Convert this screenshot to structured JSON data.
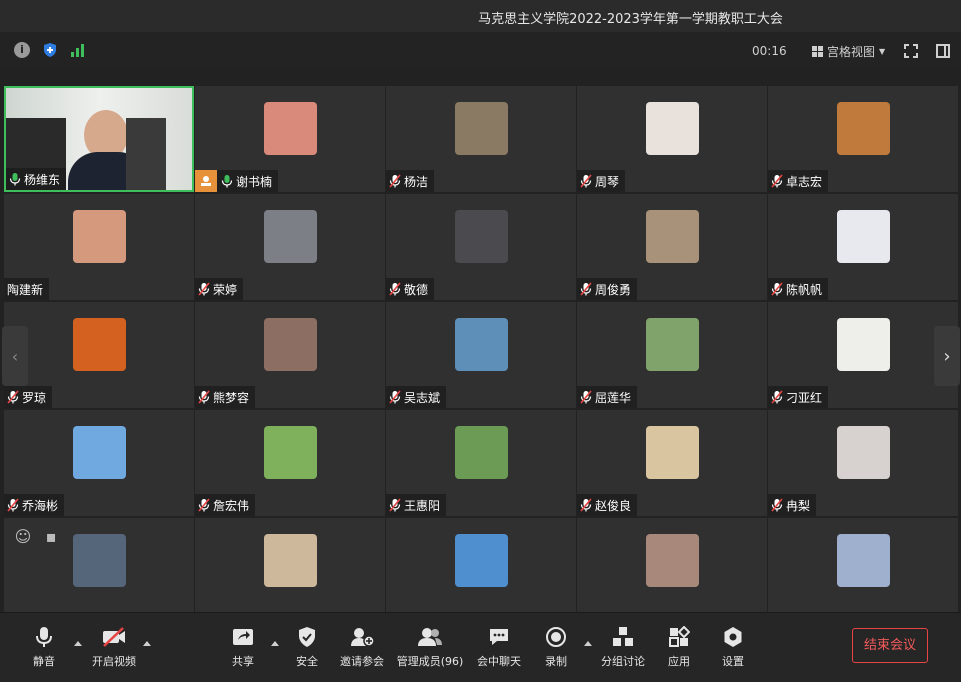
{
  "window": {
    "title": "马克思主义学院2022-2023学年第一学期教职工大会"
  },
  "infobar": {
    "timer": "00:16",
    "view_label": "宫格视图"
  },
  "participants": [
    {
      "name": "杨维东",
      "color": "#b9c7b2",
      "mic": "on",
      "active": true
    },
    {
      "name": "谢书楠",
      "color": "#d98a7a",
      "mic": "on",
      "host": true
    },
    {
      "name": "杨洁",
      "color": "#8a7a63",
      "mic": "muted"
    },
    {
      "name": "周琴",
      "color": "#e9e2dc",
      "mic": "muted"
    },
    {
      "name": "卓志宏",
      "color": "#c07a3b",
      "mic": "muted"
    },
    {
      "name": "陶建新",
      "color": "#d59a7e",
      "mic": "none"
    },
    {
      "name": "荣婷",
      "color": "#7d7f86",
      "mic": "muted"
    },
    {
      "name": "敬德",
      "color": "#4a4a4f",
      "mic": "muted"
    },
    {
      "name": "周俊勇",
      "color": "#a8927a",
      "mic": "muted"
    },
    {
      "name": "陈帆帆",
      "color": "#e7e9ee",
      "mic": "muted"
    },
    {
      "name": "罗琼",
      "color": "#d4611f",
      "mic": "muted"
    },
    {
      "name": "熊梦容",
      "color": "#8c6e62",
      "mic": "muted"
    },
    {
      "name": "吴志斌",
      "color": "#5d8fb8",
      "mic": "muted"
    },
    {
      "name": "屈莲华",
      "color": "#7fa36a",
      "mic": "muted"
    },
    {
      "name": "刁亚红",
      "color": "#eeeeea",
      "mic": "muted"
    },
    {
      "name": "乔海彬",
      "color": "#6fa9e0",
      "mic": "muted"
    },
    {
      "name": "詹宏伟",
      "color": "#7fb05c",
      "mic": "muted"
    },
    {
      "name": "王惠阳",
      "color": "#6b9b55",
      "mic": "muted"
    },
    {
      "name": "赵俊良",
      "color": "#d9c6a0",
      "mic": "muted"
    },
    {
      "name": "冉梨",
      "color": "#d7d2cf",
      "mic": "muted"
    },
    {
      "name": "",
      "color": "#55657a",
      "mic": "none"
    },
    {
      "name": "",
      "color": "#cdb89c",
      "mic": "none"
    },
    {
      "name": "",
      "color": "#4f8fd0",
      "mic": "none"
    },
    {
      "name": "",
      "color": "#a8887a",
      "mic": "none"
    },
    {
      "name": "",
      "color": "#9fb0cf",
      "mic": "none"
    }
  ],
  "toolbar": {
    "mute": "静音",
    "video": "开启视频",
    "share": "共享",
    "security": "安全",
    "invite": "邀请参会",
    "manage": "管理成员(96)",
    "chat": "会中聊天",
    "record": "录制",
    "breakout": "分组讨论",
    "apps": "应用",
    "settings": "设置",
    "end": "结束会议"
  },
  "colors": {
    "accent_green": "#3fbf5b",
    "end_red": "#e64545",
    "host_orange": "#e7913a"
  }
}
